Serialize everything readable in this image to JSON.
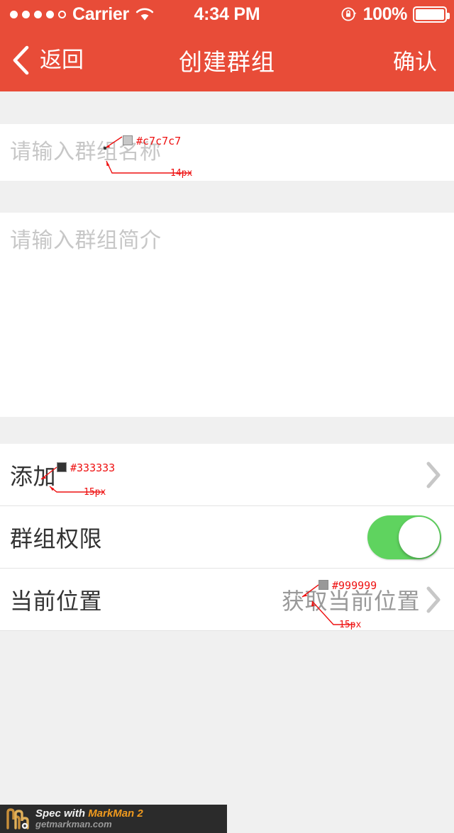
{
  "status_bar": {
    "signal_dots_total": 5,
    "signal_dots_filled": 4,
    "carrier": "Carrier",
    "wifi_icon": "wifi-icon",
    "time": "4:34 PM",
    "rotation_lock_icon": "rotation-lock-icon",
    "battery_percent": "100%",
    "battery_level": 100,
    "battery_icon": "battery-full-icon"
  },
  "nav_bar": {
    "back_icon": "chevron-left-icon",
    "back_label": "返回",
    "title": "创建群组",
    "right_label": "确认",
    "background_color": "#e84c38"
  },
  "form": {
    "name_placeholder": "请输入群组名称",
    "name_value": "",
    "intro_placeholder": "请输入群组简介",
    "intro_value": ""
  },
  "rows": [
    {
      "label": "添加",
      "value": "",
      "accessory": "chevron-right-icon"
    },
    {
      "label": "群组权限",
      "value": "",
      "accessory": "toggle",
      "toggle_on": true,
      "toggle_color": "#5fd35f"
    },
    {
      "label": "当前位置",
      "value": "获取当前位置",
      "accessory": "chevron-right-icon"
    }
  ],
  "annotations": [
    {
      "id": "name-color",
      "color_label": "#c7c7c7",
      "swatch": "#c7c7c7"
    },
    {
      "id": "name-size",
      "size_label": "14px"
    },
    {
      "id": "add-color",
      "color_label": "#333333",
      "swatch": "#333333"
    },
    {
      "id": "add-size",
      "size_label": "15px"
    },
    {
      "id": "location-color",
      "color_label": "#999999",
      "swatch": "#999999"
    },
    {
      "id": "location-size",
      "size_label": "15px"
    }
  ],
  "watermark": {
    "prefix": "Spec with ",
    "brand": "MarkMan 2",
    "url": "getmarkman.com"
  }
}
